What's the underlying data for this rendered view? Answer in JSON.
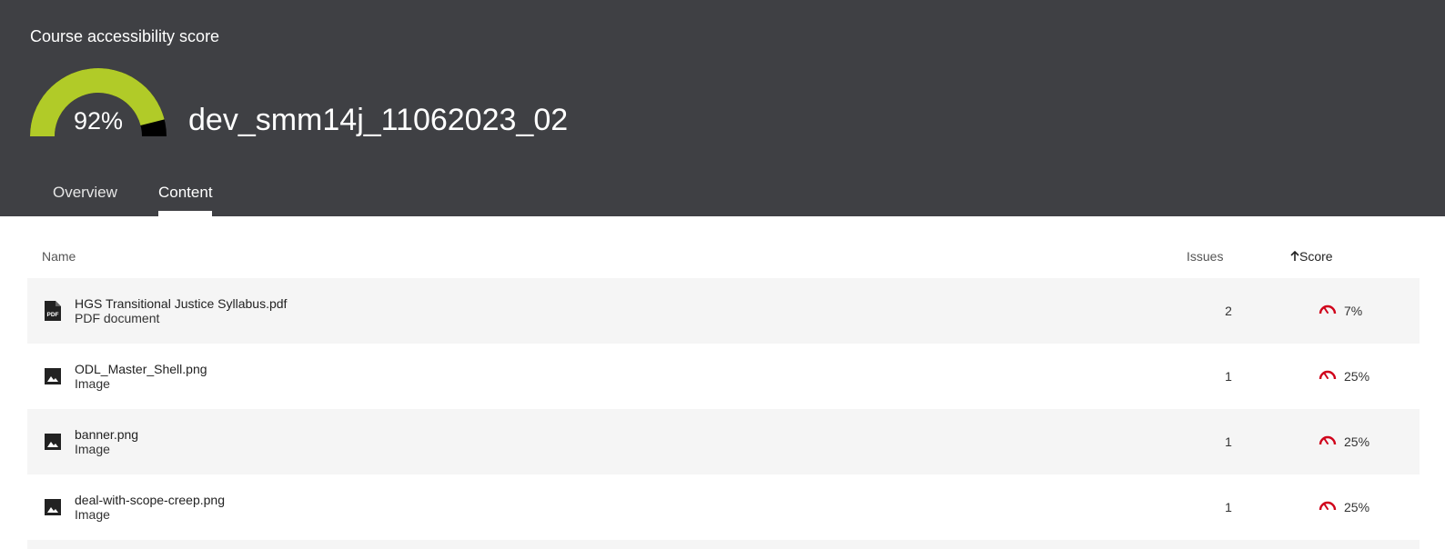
{
  "header": {
    "title": "Course accessibility score",
    "score_label": "92%",
    "score_fraction": 0.92,
    "course_name": "dev_smm14j_11062023_02",
    "gauge_color": "#b1cb28"
  },
  "tabs": [
    {
      "label": "Overview",
      "active": false
    },
    {
      "label": "Content",
      "active": true
    }
  ],
  "table": {
    "columns": {
      "name": "Name",
      "issues": "Issues",
      "score": "Score",
      "score_sort": "ascending"
    },
    "rows": [
      {
        "name": "HGS Transitional Justice Syllabus.pdf",
        "type": "PDF document",
        "icon": "pdf-icon",
        "issues": "2",
        "score": "7%"
      },
      {
        "name": "ODL_Master_Shell.png",
        "type": "Image",
        "icon": "image-icon",
        "issues": "1",
        "score": "25%"
      },
      {
        "name": "banner.png",
        "type": "Image",
        "icon": "image-icon",
        "issues": "1",
        "score": "25%"
      },
      {
        "name": "deal-with-scope-creep.png",
        "type": "Image",
        "icon": "image-icon",
        "issues": "1",
        "score": "25%"
      }
    ]
  },
  "colors": {
    "header_bg": "#3f4044",
    "score_low": "#d0021b",
    "row_shade": "#f5f5f5"
  }
}
